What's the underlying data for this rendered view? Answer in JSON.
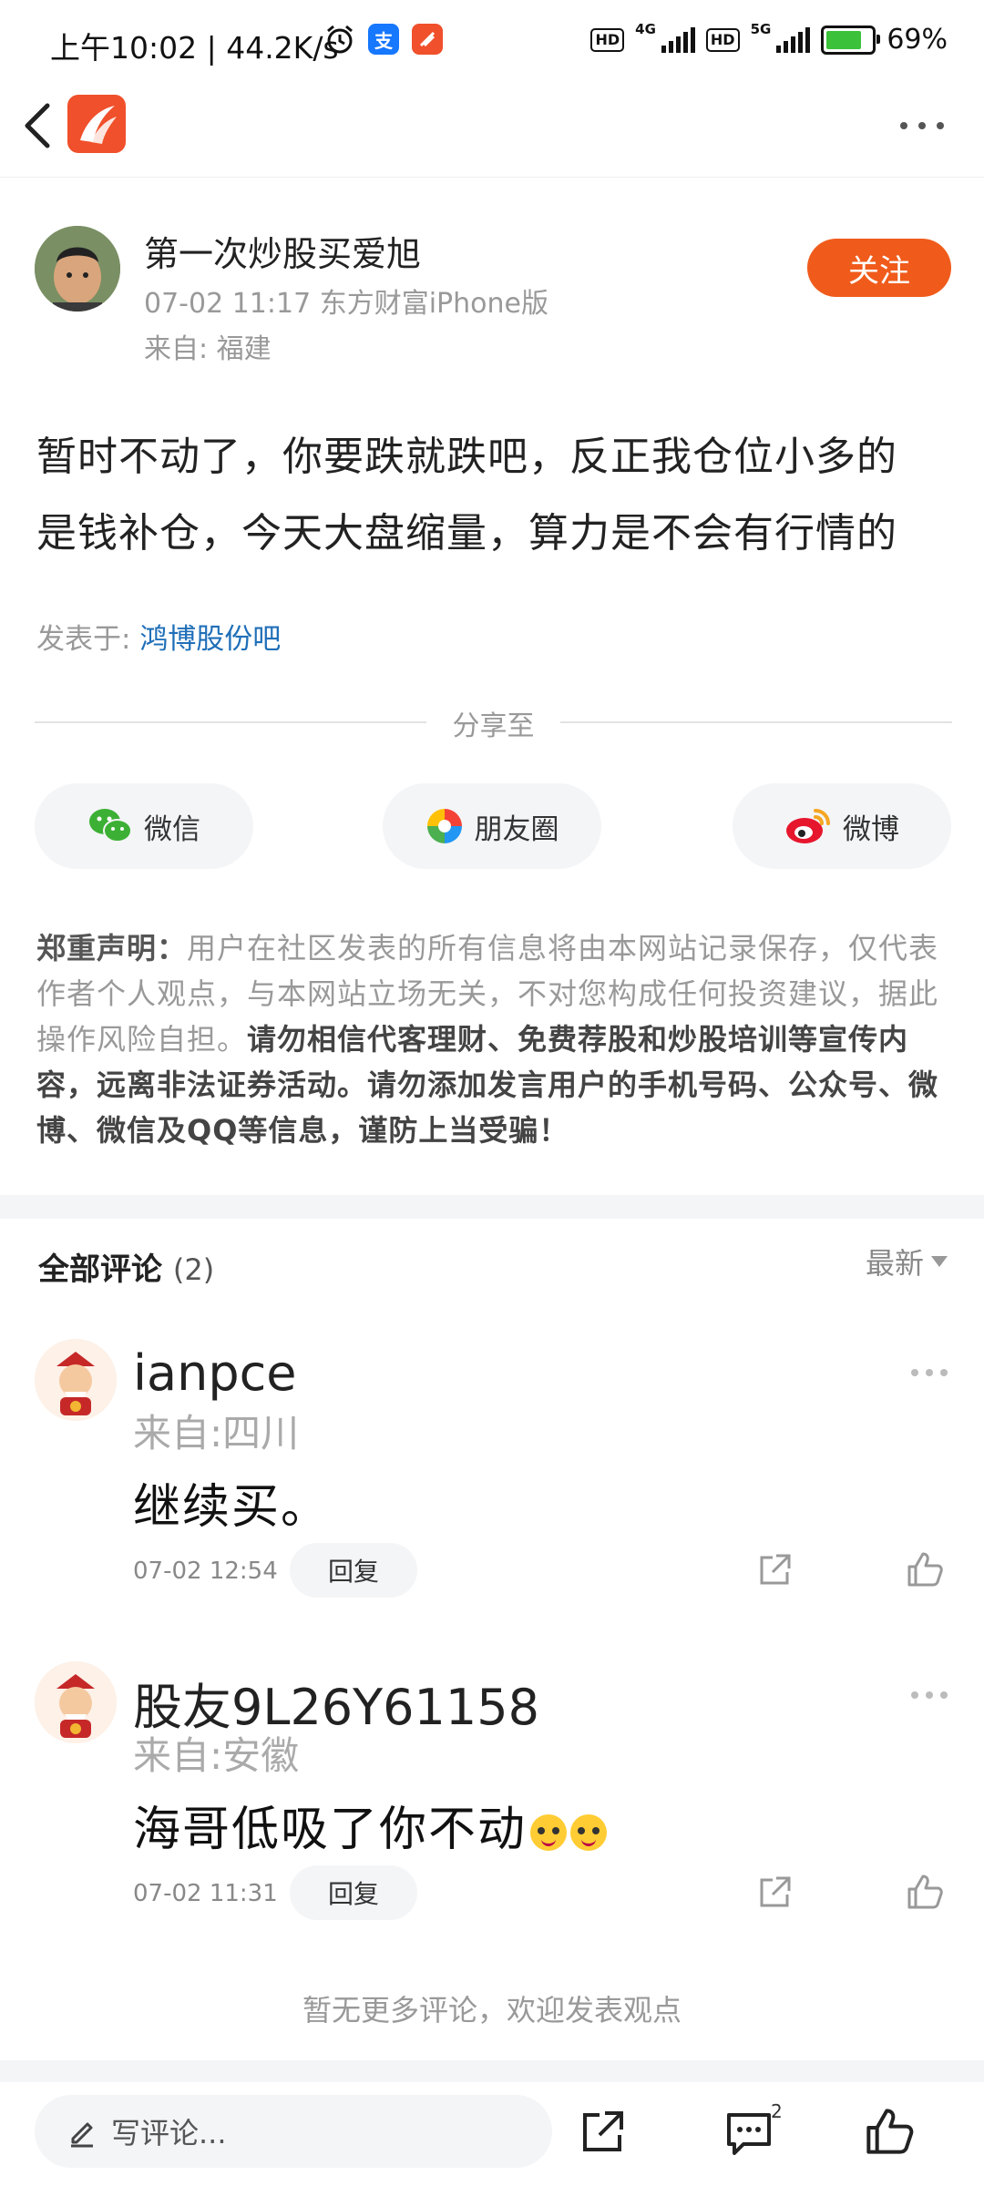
{
  "status_bar": {
    "time_speed": "上午10:02 | 44.2K/s",
    "net1": "4G",
    "net2": "5G",
    "hd": "HD",
    "battery": "69%",
    "battery_level": 0.69
  },
  "nav": {
    "logo_color": "#f0502b"
  },
  "post": {
    "author": "第一次炒股买爱旭",
    "meta": "07-02 11:17 东方财富iPhone版",
    "from": "来自: 福建",
    "follow_label": "关注",
    "content_line1": "暂时不动了，你要跌就跌吧，反正我仓位小多的",
    "content_line2": "是钱补仓，今天大盘缩量，算力是不会有行情的",
    "posted_in_label": "发表于:",
    "posted_in_link": "鸿博股份吧"
  },
  "share": {
    "label": "分享至",
    "buttons": [
      {
        "label": "微信",
        "icon": "wechat-icon"
      },
      {
        "label": "朋友圈",
        "icon": "moments-icon"
      },
      {
        "label": "微博",
        "icon": "weibo-icon"
      }
    ]
  },
  "disclaimer": {
    "head": "郑重声明：",
    "normal": "用户在社区发表的所有信息将由本网站记录保存，仅代表作者个人观点，与本网站立场无关，不对您构成任何投资建议，据此操作风险自担。",
    "warning": "请勿相信代客理财、免费荐股和炒股培训等宣传内容，远离非法证券活动。请勿添加发言用户的手机号码、公众号、微博、微信及QQ等信息，谨防上当受骗！"
  },
  "comments_section": {
    "title": "全部评论",
    "count": "(2)",
    "sort_label": "最新",
    "items": [
      {
        "name": "ianpce",
        "from": "来自:四川",
        "text": "继续买。",
        "time": "07-02 12:54",
        "reply_label": "回复",
        "emojis": 0
      },
      {
        "name": "股友9L26Y61158",
        "from": "来自:安徽",
        "text": "海哥低吸了你不动",
        "time": "07-02 11:31",
        "reply_label": "回复",
        "emojis": 2
      }
    ],
    "no_more": "暂无更多评论，欢迎发表观点"
  },
  "bottom_bar": {
    "input_placeholder": "写评论...",
    "comment_badge": "2"
  },
  "colors": {
    "accent": "#f05b1b",
    "link": "#1f6fb8",
    "wechat_green": "#3cb034",
    "weibo_red": "#e6162d"
  }
}
